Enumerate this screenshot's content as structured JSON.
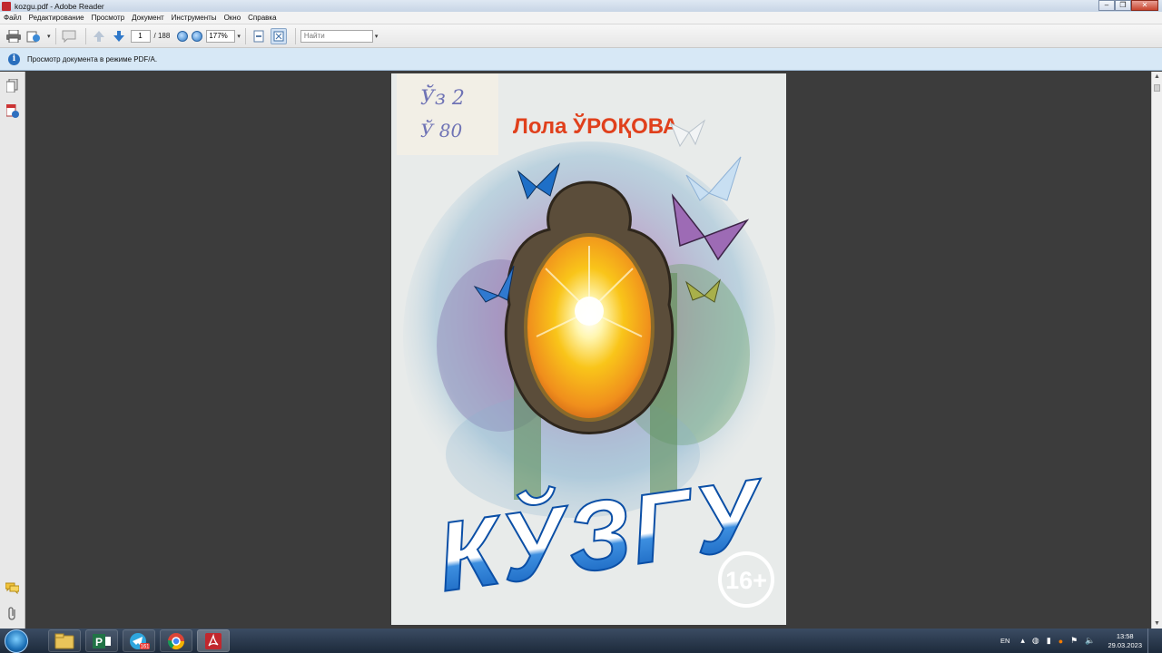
{
  "window": {
    "title": "kozgu.pdf - Adobe Reader",
    "controls": {
      "minimize": "–",
      "maximize": "❐",
      "close": "✕"
    }
  },
  "menu": [
    "Файл",
    "Редактирование",
    "Просмотр",
    "Документ",
    "Инструменты",
    "Окно",
    "Справка"
  ],
  "toolbar": {
    "current_page": "1",
    "total_pages": "/ 188",
    "zoom": "177%",
    "find_placeholder": "Найти"
  },
  "infobar": {
    "message": "Просмотр документа в режиме PDF/A."
  },
  "document": {
    "author": "Лола ЎРОҚОВА",
    "title": "КЎЗГУ",
    "age_rating": "16+",
    "library_mark_1": "Ўз 2",
    "library_mark_2": "Ў 80"
  },
  "taskbar": {
    "apps": [
      "file-explorer",
      "project",
      "telegram",
      "chrome",
      "adobe-reader"
    ],
    "telegram_badge": "161",
    "language": "EN",
    "time": "13:58",
    "date": "29.03.2023"
  }
}
